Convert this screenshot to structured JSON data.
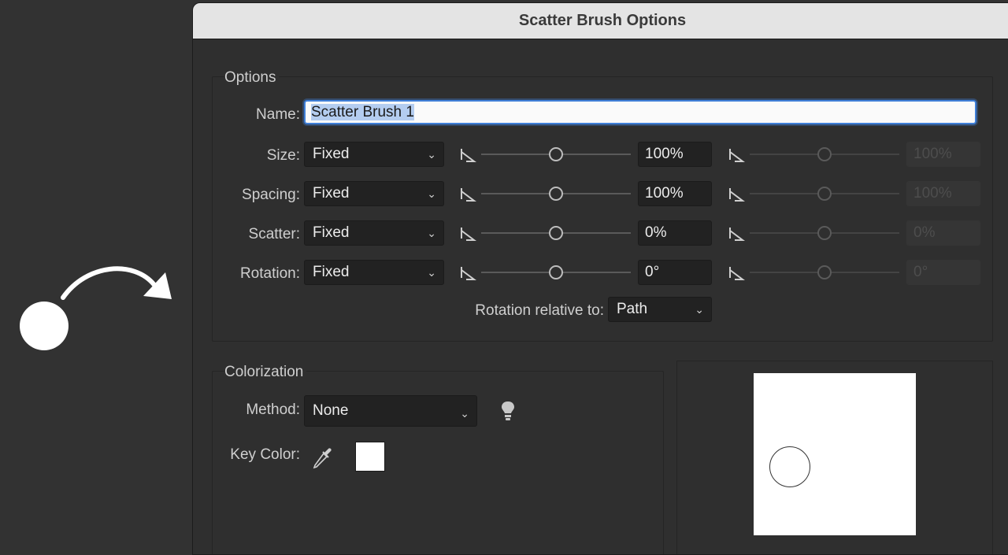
{
  "dialog": {
    "title": "Scatter Brush Options"
  },
  "options": {
    "group_title": "Options",
    "name_label": "Name:",
    "name_value": "Scatter Brush 1",
    "rows": [
      {
        "label": "Size:",
        "mode": "Fixed",
        "value": "100%",
        "value2": "100%",
        "level": 0.5
      },
      {
        "label": "Spacing:",
        "mode": "Fixed",
        "value": "100%",
        "value2": "100%",
        "level": 0.5
      },
      {
        "label": "Scatter:",
        "mode": "Fixed",
        "value": "0%",
        "value2": "0%",
        "level": 0.5
      },
      {
        "label": "Rotation:",
        "mode": "Fixed",
        "value": "0°",
        "value2": "0°",
        "level": 0.5
      }
    ],
    "rotation_relative_label": "Rotation relative to:",
    "rotation_relative_value": "Path"
  },
  "colorization": {
    "group_title": "Colorization",
    "method_label": "Method:",
    "method_value": "None",
    "key_color_label": "Key Color:",
    "key_color": "#ffffff"
  },
  "colors": {
    "accent": "#3f7fd8",
    "dialog_bg": "#2f2f2f",
    "titlebar_bg": "#e4e4e4"
  },
  "icons": {
    "tips": "lightbulb-icon",
    "eyedropper": "eyedropper-icon",
    "variation": "variation-lock-icon"
  }
}
